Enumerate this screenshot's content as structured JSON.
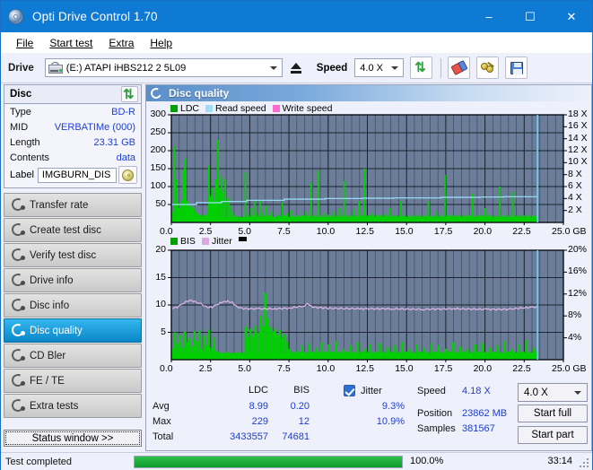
{
  "window": {
    "title": "Opti Drive Control 1.70",
    "icon": "disc-icon",
    "minimize": "–",
    "maximize": "☐",
    "close": "✕"
  },
  "menu": {
    "items": [
      "File",
      "Start test",
      "Extra",
      "Help"
    ]
  },
  "toolbar": {
    "drive_label": "Drive",
    "drive_value": "(E:)  ATAPI iHBS212  2 5L09",
    "eject_title": "eject-button",
    "speed_label": "Speed",
    "speed_value": "4.0 X",
    "buttons": [
      "refresh-icon",
      "eraser-icon",
      "keys-icon",
      "save-icon"
    ]
  },
  "disc": {
    "header": "Disc",
    "refresh_icon": "refresh-icon",
    "rows": [
      {
        "key": "Type",
        "value": "BD-R"
      },
      {
        "key": "MID",
        "value": "VERBATIMe (000)"
      },
      {
        "key": "Length",
        "value": "23.31 GB"
      },
      {
        "key": "Contents",
        "value": "data"
      }
    ],
    "label_key": "Label",
    "label_value": "IMGBURN_DIS"
  },
  "nav": {
    "items": [
      {
        "label": "Transfer rate",
        "selected": false
      },
      {
        "label": "Create test disc",
        "selected": false
      },
      {
        "label": "Verify test disc",
        "selected": false
      },
      {
        "label": "Drive info",
        "selected": false
      },
      {
        "label": "Disc info",
        "selected": false
      },
      {
        "label": "Disc quality",
        "selected": true
      },
      {
        "label": "CD Bler",
        "selected": false
      },
      {
        "label": "FE / TE",
        "selected": false
      },
      {
        "label": "Extra tests",
        "selected": false
      }
    ],
    "status_window": "Status window >>"
  },
  "panel": {
    "title": "Disc quality",
    "icon": "disc-quality-icon"
  },
  "chart_data": [
    {
      "type": "area",
      "title": "LDC / Read speed",
      "legend": [
        {
          "label": "LDC",
          "color": "#00a000"
        },
        {
          "label": "Read speed",
          "color": "#87ceeb"
        },
        {
          "label": "Write speed",
          "color": "#ff66cc"
        }
      ],
      "legend_position": "top-left",
      "xlabel": "GB",
      "x": [
        0.0,
        2.5,
        5.0,
        7.5,
        10.0,
        12.5,
        15.0,
        17.5,
        20.0,
        22.5,
        25.0
      ],
      "xlim": [
        0,
        25
      ],
      "ylabel": "",
      "yticks": [
        50,
        100,
        150,
        200,
        250,
        300
      ],
      "ylim": [
        0,
        300
      ],
      "y2label": "X",
      "y2ticks": [
        "2 X",
        "4 X",
        "6 X",
        "8 X",
        "10 X",
        "12 X",
        "14 X",
        "16 X",
        "18 X"
      ],
      "y2lim": [
        0,
        18
      ],
      "grid": true,
      "plot_bg": "#6b7d99",
      "series": [
        {
          "name": "LDC",
          "color": "#00d000",
          "kind": "spikes",
          "note": "dense green error spikes across 0-23.3 GB, heaviest 0-4.2 GB",
          "baseline": 14,
          "values": [
            30,
            212,
            120,
            55,
            40,
            62,
            148,
            178,
            60,
            44,
            52,
            38,
            44,
            28,
            24,
            20,
            22,
            18,
            20,
            24,
            158,
            74,
            96,
            62,
            120,
            230,
            96,
            130,
            86,
            120,
            64,
            70,
            46,
            30,
            22,
            18,
            16,
            18,
            14,
            16,
            140,
            22,
            18,
            40,
            20,
            60,
            26,
            18,
            60,
            24,
            16,
            46,
            20,
            18,
            30,
            16,
            14,
            18,
            22,
            16,
            56,
            20,
            18,
            28,
            16,
            34,
            18,
            14,
            22,
            18,
            16,
            20,
            18,
            30,
            20,
            16,
            112,
            18,
            22,
            16,
            145,
            20,
            16,
            26,
            18,
            22,
            16,
            20,
            30,
            18,
            16,
            40,
            22,
            18,
            116,
            20,
            16,
            22,
            18,
            36,
            20,
            16,
            60,
            18,
            22,
            150,
            16,
            20,
            18,
            26,
            20,
            16,
            22,
            18,
            20,
            16,
            24,
            18,
            16,
            40,
            22,
            16,
            18,
            20,
            16,
            60,
            18,
            22,
            16,
            18,
            20,
            16,
            18,
            22,
            16,
            20,
            18,
            16,
            22,
            18,
            60,
            18,
            16,
            20,
            30,
            16,
            18,
            22,
            16,
            132,
            18,
            20,
            16,
            22,
            18,
            16,
            20,
            18,
            16,
            22,
            18,
            16,
            20,
            18,
            80,
            16,
            18,
            22,
            16,
            20,
            18,
            40,
            16,
            22,
            18,
            16,
            20,
            18,
            16,
            100,
            18,
            20,
            16,
            22,
            18,
            16,
            86,
            20,
            18,
            16,
            22,
            18,
            20,
            16,
            18,
            22,
            16,
            20,
            18,
            16
          ]
        },
        {
          "name": "Read speed",
          "color": "#9fe3ff",
          "kind": "step-line",
          "unit": "X",
          "points": [
            [
              0.0,
              3.0
            ],
            [
              1.5,
              3.0
            ],
            [
              1.6,
              3.3
            ],
            [
              3.0,
              3.3
            ],
            [
              3.2,
              3.5
            ],
            [
              4.6,
              3.5
            ],
            [
              4.8,
              3.7
            ],
            [
              7.0,
              3.7
            ],
            [
              7.2,
              3.9
            ],
            [
              9.6,
              3.9
            ],
            [
              9.8,
              4.0
            ],
            [
              12.0,
              4.0
            ],
            [
              12.2,
              4.05
            ],
            [
              14.0,
              4.05
            ],
            [
              14.2,
              4.1
            ],
            [
              17.0,
              4.1
            ],
            [
              17.2,
              4.2
            ],
            [
              19.5,
              4.2
            ],
            [
              19.7,
              4.25
            ],
            [
              21.0,
              4.25
            ],
            [
              21.2,
              4.3
            ],
            [
              23.2,
              4.3
            ],
            [
              23.35,
              18.0
            ]
          ]
        }
      ]
    },
    {
      "type": "area",
      "title": "BIS / Jitter",
      "legend": [
        {
          "label": "BIS",
          "color": "#00a000"
        },
        {
          "label": "Jitter",
          "color": "#d9a8e0"
        },
        {
          "label": "",
          "color": "#000000"
        }
      ],
      "legend_position": "top-left",
      "xlabel": "GB",
      "x": [
        0.0,
        2.5,
        5.0,
        7.5,
        10.0,
        12.5,
        15.0,
        17.5,
        20.0,
        22.5,
        25.0
      ],
      "xlim": [
        0,
        25
      ],
      "yticks": [
        5,
        10,
        15,
        20
      ],
      "ylim": [
        0,
        20
      ],
      "y2ticks": [
        "4%",
        "8%",
        "12%",
        "16%",
        "20%"
      ],
      "y2lim": [
        0,
        20
      ],
      "grid": true,
      "plot_bg": "#6b7d99",
      "series": [
        {
          "name": "BIS",
          "color": "#00d000",
          "kind": "spikes",
          "baseline": 1.2,
          "values": [
            2.0,
            5.0,
            3.0,
            4.6,
            2.2,
            5.1,
            3.2,
            4.0,
            2.4,
            5.2,
            3.4,
            5.3,
            2.0,
            4.4,
            2.6,
            5.5,
            2.2,
            4.0,
            1.6,
            1.4,
            1.3,
            1.2,
            1.4,
            1.3,
            1.2,
            1.3,
            1.2,
            1.4,
            1.3,
            1.2,
            6.0,
            4.0,
            5.6,
            4.4,
            6.2,
            5.0,
            8.0,
            6.2,
            12.2,
            7.6,
            6.0,
            5.2,
            5.8,
            4.6,
            5.4,
            4.0,
            4.6,
            3.2,
            2.0,
            1.4,
            1.3,
            1.6,
            1.4,
            2.6,
            1.4,
            1.3,
            3.0,
            1.5,
            1.4,
            2.2,
            1.4,
            3.2,
            1.5,
            1.4,
            2.8,
            1.4,
            1.5,
            3.4,
            1.4,
            1.3,
            2.0,
            1.5,
            1.4,
            2.6,
            1.4,
            1.3,
            3.2,
            1.4,
            1.5,
            2.0,
            1.4,
            2.8,
            1.3,
            1.5,
            1.4,
            3.0,
            1.4,
            1.3,
            2.2,
            1.5,
            1.4,
            2.6,
            1.3,
            1.4,
            3.2,
            1.4,
            1.5,
            2.0,
            1.4,
            1.3,
            2.8,
            1.5,
            1.4,
            2.2,
            1.4,
            1.3,
            3.0,
            1.4,
            1.5,
            2.6,
            1.4,
            1.3,
            2.0,
            1.5,
            1.4,
            3.2,
            1.4,
            1.3,
            2.4,
            1.5,
            1.4,
            2.0,
            1.3,
            1.4,
            2.8,
            1.4,
            1.5,
            3.0,
            1.4,
            1.3,
            2.2,
            1.5,
            1.4,
            2.6,
            1.4,
            1.3,
            3.4,
            1.4,
            1.5,
            2.0,
            1.4,
            1.3,
            2.8,
            1.5,
            1.4,
            3.6,
            1.4,
            1.3,
            2.2,
            1.5
          ]
        },
        {
          "name": "Jitter",
          "color": "#e2b6e8",
          "kind": "line",
          "unit": "%",
          "avg": 9.3,
          "max": 10.9,
          "points": [
            [
              0.0,
              9.3
            ],
            [
              0.4,
              9.6
            ],
            [
              0.8,
              10.4
            ],
            [
              1.2,
              10.9
            ],
            [
              1.5,
              10.6
            ],
            [
              1.9,
              10.2
            ],
            [
              2.3,
              9.5
            ],
            [
              2.6,
              9.6
            ],
            [
              3.0,
              10.2
            ],
            [
              3.3,
              10.6
            ],
            [
              3.6,
              10.7
            ],
            [
              3.9,
              10.4
            ],
            [
              4.2,
              9.6
            ],
            [
              4.6,
              9.3
            ],
            [
              5.5,
              9.3
            ],
            [
              6.5,
              9.3
            ],
            [
              7.5,
              9.4
            ],
            [
              8.4,
              9.8
            ],
            [
              8.7,
              10.2
            ],
            [
              9.0,
              9.6
            ],
            [
              10.0,
              9.4
            ],
            [
              12.0,
              9.3
            ],
            [
              14.0,
              9.3
            ],
            [
              16.0,
              9.2
            ],
            [
              18.0,
              9.3
            ],
            [
              20.0,
              9.2
            ],
            [
              21.5,
              9.2
            ],
            [
              22.5,
              9.5
            ],
            [
              23.0,
              9.6
            ],
            [
              23.3,
              9.6
            ]
          ]
        }
      ]
    }
  ],
  "stats": {
    "col_ldc": "LDC",
    "col_bis": "BIS",
    "jitter_label": "Jitter",
    "jitter_checked": true,
    "rows": [
      {
        "name": "Avg",
        "ldc": "8.99",
        "bis": "0.20",
        "jitter": "9.3%"
      },
      {
        "name": "Max",
        "ldc": "229",
        "bis": "12",
        "jitter": "10.9%"
      },
      {
        "name": "Total",
        "ldc": "3433557",
        "bis": "74681",
        "jitter": ""
      }
    ],
    "speed_label": "Speed",
    "speed_value": "4.18 X",
    "position_label": "Position",
    "position_value": "23862 MB",
    "samples_label": "Samples",
    "samples_value": "381567",
    "speed_select": "4.0 X",
    "start_full": "Start full",
    "start_part": "Start part"
  },
  "statusbar": {
    "message": "Test completed",
    "progress_pct": "100.0%",
    "progress_value": 100,
    "elapsed": "33:14"
  }
}
